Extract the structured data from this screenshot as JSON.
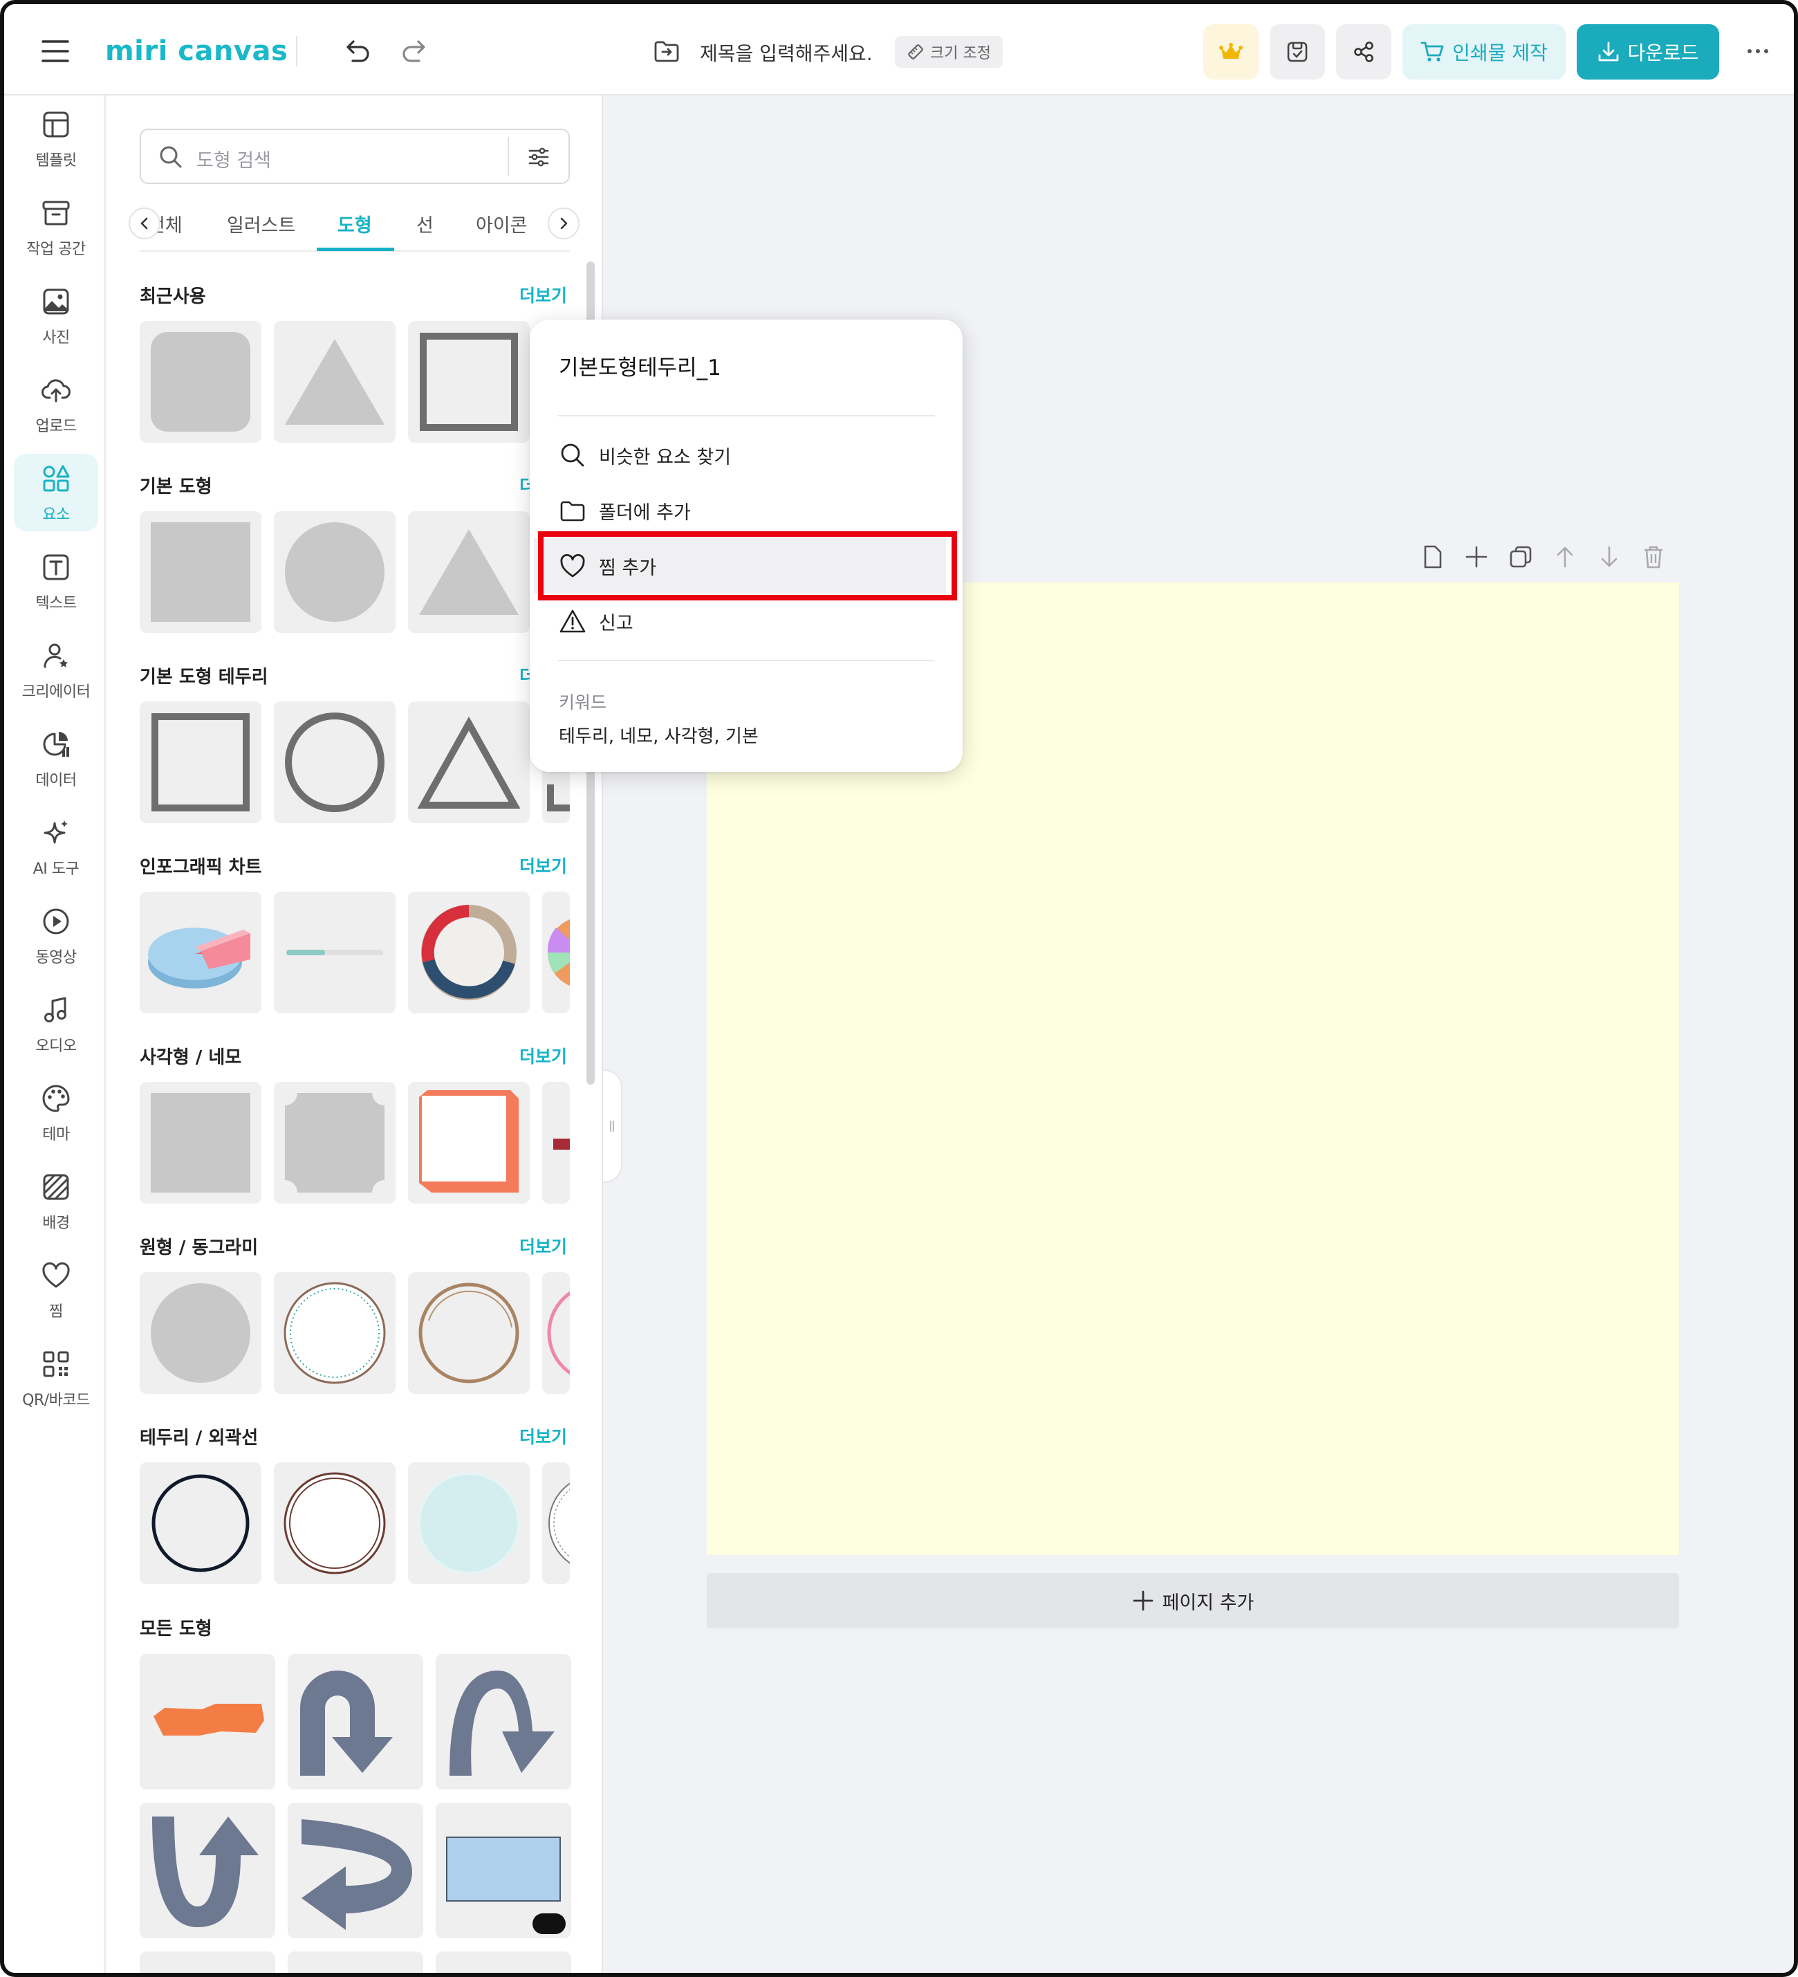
{
  "app": {
    "logo_text": "miri canvas",
    "doc_title_placeholder": "제목을 입력해주세요.",
    "resize_label": "크기 조정",
    "print_label": "인쇄물 제작",
    "download_label": "다운로드",
    "accent_color": "#1aabbd"
  },
  "rail": {
    "items": [
      {
        "label": "템플릿",
        "icon": "template-icon"
      },
      {
        "label": "작업 공간",
        "icon": "workspace-icon"
      },
      {
        "label": "사진",
        "icon": "photo-icon"
      },
      {
        "label": "업로드",
        "icon": "upload-icon"
      },
      {
        "label": "요소",
        "icon": "elements-icon",
        "active": true
      },
      {
        "label": "텍스트",
        "icon": "text-icon"
      },
      {
        "label": "크리에이터",
        "icon": "creator-icon"
      },
      {
        "label": "데이터",
        "icon": "data-icon"
      },
      {
        "label": "AI 도구",
        "icon": "ai-tools-icon"
      },
      {
        "label": "동영상",
        "icon": "video-icon"
      },
      {
        "label": "오디오",
        "icon": "audio-icon"
      },
      {
        "label": "테마",
        "icon": "palette-icon"
      },
      {
        "label": "배경",
        "icon": "background-icon"
      },
      {
        "label": "찜",
        "icon": "heart-icon"
      },
      {
        "label": "QR/바코드",
        "icon": "qr-icon"
      }
    ]
  },
  "panel": {
    "search_placeholder": "도형 검색",
    "tabs": [
      "전체",
      "일러스트",
      "도형",
      "선",
      "아이콘"
    ],
    "active_tab": "도형",
    "more_label": "더보기",
    "sections": {
      "recent": "최근사용",
      "basic": "기본 도형",
      "basic_border": "기본 도형 테두리",
      "infographic": "인포그래픽 차트",
      "rect": "사각형 / 네모",
      "circle": "원형 / 동그라미",
      "border": "테두리 / 외곽선",
      "all": "모든 도형"
    }
  },
  "context_menu": {
    "title": "기본도형테두리_1",
    "items": [
      {
        "label": "비슷한 요소 찾기",
        "icon": "search-icon"
      },
      {
        "label": "폴더에 추가",
        "icon": "folder-icon"
      },
      {
        "label": "찜 추가",
        "icon": "heart-icon",
        "highlighted": true
      },
      {
        "label": "신고",
        "icon": "warning-icon"
      }
    ],
    "keyword_title": "키워드",
    "keywords": "테두리, 네모, 사각형, 기본"
  },
  "canvas": {
    "page_color": "#fefee0",
    "add_page_label": "페이지 추가"
  }
}
